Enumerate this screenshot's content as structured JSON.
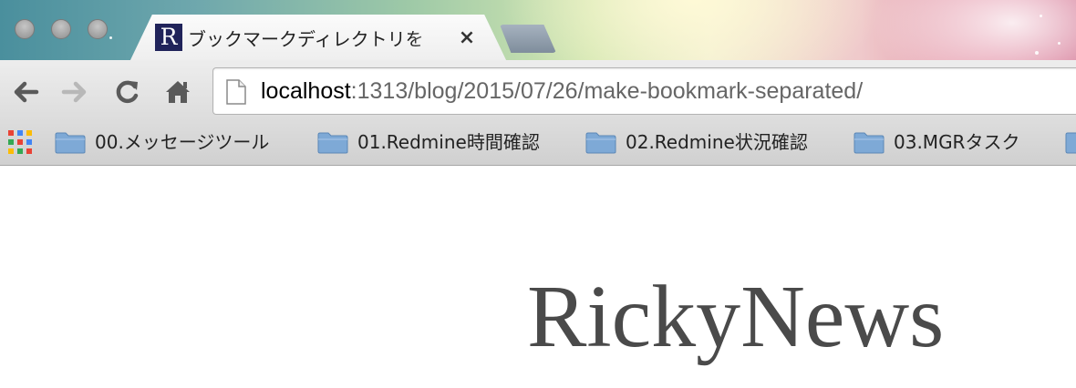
{
  "window": {
    "buttons": [
      "close",
      "minimize",
      "zoom"
    ]
  },
  "tabs": [
    {
      "favicon_letter": "R",
      "title": "ブックマークディレクトリを",
      "close_glyph": "×",
      "active": true
    }
  ],
  "toolbar": {
    "back_icon": "back-arrow-icon",
    "forward_icon": "forward-arrow-icon",
    "reload_icon": "reload-icon",
    "home_icon": "home-icon"
  },
  "address_bar": {
    "host": "localhost",
    "path": ":1313/blog/2015/07/26/make-bookmark-separated/"
  },
  "bookmarks": {
    "apps_icon": "apps-grid-icon",
    "items": [
      {
        "label": "00.メッセージツール",
        "icon": "folder-icon"
      },
      {
        "label": "01.Redmine時間確認",
        "icon": "folder-icon"
      },
      {
        "label": "02.Redmine状況確認",
        "icon": "folder-icon"
      },
      {
        "label": "03.MGRタスク",
        "icon": "folder-icon"
      },
      {
        "label": "",
        "icon": "folder-icon"
      }
    ]
  },
  "page": {
    "site_title": "RickyNews"
  },
  "colors": {
    "tab_favicon_bg": "#20235a",
    "folder_blue": "#7ea9d6",
    "site_title": "#4a4a4a"
  }
}
